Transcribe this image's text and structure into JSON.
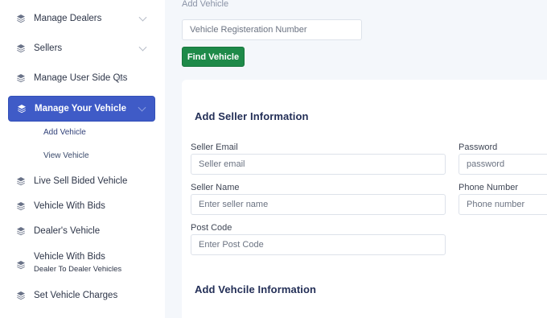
{
  "sidebar": {
    "items": [
      {
        "label": "Manage Dealers"
      },
      {
        "label": "Sellers"
      },
      {
        "label": "Manage User Side Qts"
      },
      {
        "label": "Manage Your Vehicle"
      },
      {
        "label": "Live Sell Bided Vehicle"
      },
      {
        "label": "Vehicle With Bids"
      },
      {
        "label": "Dealer's Vehicle"
      },
      {
        "label": "Vehicle With Bids",
        "sub": "Dealer To Dealer Vehicles"
      },
      {
        "label": "Set Vehicle Charges"
      }
    ],
    "submenu": [
      {
        "label": "Add Vehicle"
      },
      {
        "label": "View Vehicle"
      }
    ],
    "accent": "#3f5bc7"
  },
  "main": {
    "page_title": "Add Vehicle",
    "registration": {
      "placeholder": "Vehicle Registeration Number",
      "value": ""
    },
    "find_button": "Find Vehicle",
    "seller_section_title": "Add Seller Information",
    "fields": {
      "seller_email": {
        "label": "Seller Email",
        "placeholder": "Seller email"
      },
      "password": {
        "label": "Password",
        "placeholder": "password"
      },
      "seller_name": {
        "label": "Seller Name",
        "placeholder": "Enter seller name"
      },
      "phone": {
        "label": "Phone Number",
        "placeholder": "Phone number"
      },
      "post_code": {
        "label": "Post Code",
        "placeholder": "Enter Post Code"
      }
    },
    "vehicle_section_title": "Add Vehcile Information",
    "button_color": "#1e8a49"
  }
}
